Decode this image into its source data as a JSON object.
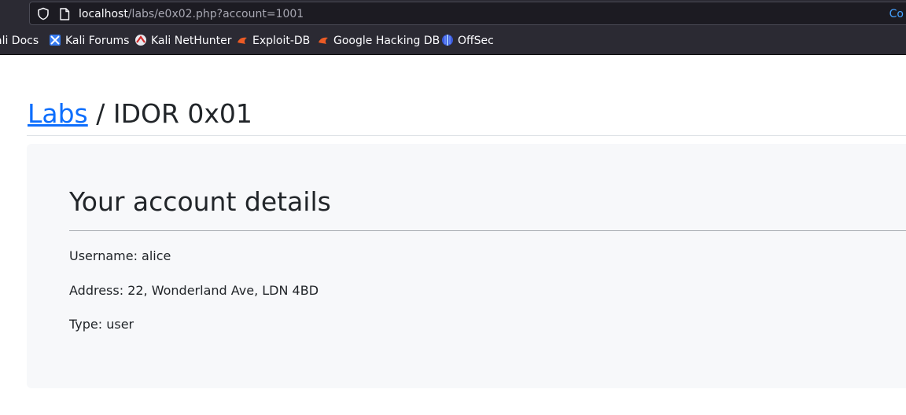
{
  "browser": {
    "url_host": "localhost",
    "url_path": "/labs/e0x02.php?account=1001",
    "url_right_hint": "Co",
    "bookmarks": [
      {
        "label": "ali Docs",
        "icon": "kali-docs-icon"
      },
      {
        "label": "Kali Forums",
        "icon": "kali-forums-icon"
      },
      {
        "label": "Kali NetHunter",
        "icon": "kali-nethunter-icon"
      },
      {
        "label": "Exploit-DB",
        "icon": "exploit-db-icon"
      },
      {
        "label": "Google Hacking DB",
        "icon": "google-hacking-db-icon"
      },
      {
        "label": "OffSec",
        "icon": "offsec-icon"
      }
    ]
  },
  "page": {
    "breadcrumb_link": "Labs",
    "breadcrumb_rest": " / IDOR 0x01",
    "card": {
      "title": "Your account details",
      "username": "Username: alice",
      "address": "Address: 22, Wonderland Ave, LDN 4BD",
      "type": "Type: user"
    }
  },
  "colors": {
    "link": "#0d6efd",
    "chrome_bg": "#2b2a33",
    "card_bg": "#f7f8fa"
  }
}
